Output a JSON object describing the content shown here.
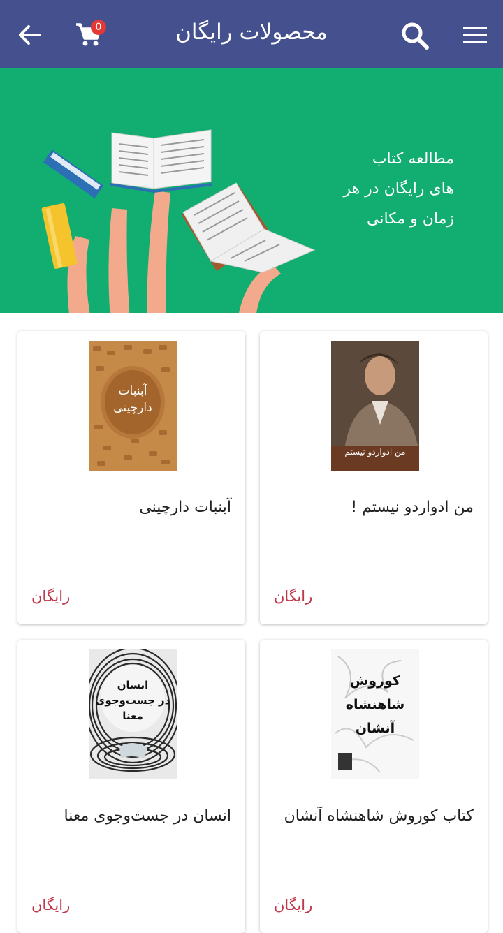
{
  "appbar": {
    "title": "محصولات رایگان",
    "cart_count": "0",
    "bg_color": "#45508f"
  },
  "icons": [
    "back-arrow-icon",
    "cart-icon",
    "search-icon",
    "hamburger-menu-icon"
  ],
  "banner": {
    "bg_color": "#12ad70",
    "line1": "مطالعه کتاب",
    "line2": "های رایگان در هر",
    "line3": "زمان و مکانی"
  },
  "products": [
    {
      "title": "من ادواردو نیستم !",
      "price": "رایگان"
    },
    {
      "title": "آبنبات دارچینی",
      "price": "رایگان"
    },
    {
      "title": "کتاب کوروش شاهنشاه آنشان",
      "price": "رایگان"
    },
    {
      "title": "انسان در جست‌وجوی معنا",
      "price": "رایگان"
    }
  ],
  "cover_texts": {
    "eduardo_cover": "من ادواردو نیستم",
    "cinnamon_cover_1": "آبنبات",
    "cinnamon_cover_2": "دارچینی",
    "cyrus_cover_1": "کوروش",
    "cyrus_cover_2": "شاهنشاه",
    "cyrus_cover_3": "آنشان",
    "meaning_cover_1": "انسان",
    "meaning_cover_2": "در جست‌وجوی",
    "meaning_cover_3": "معنا"
  },
  "price_color": "#c0394b"
}
